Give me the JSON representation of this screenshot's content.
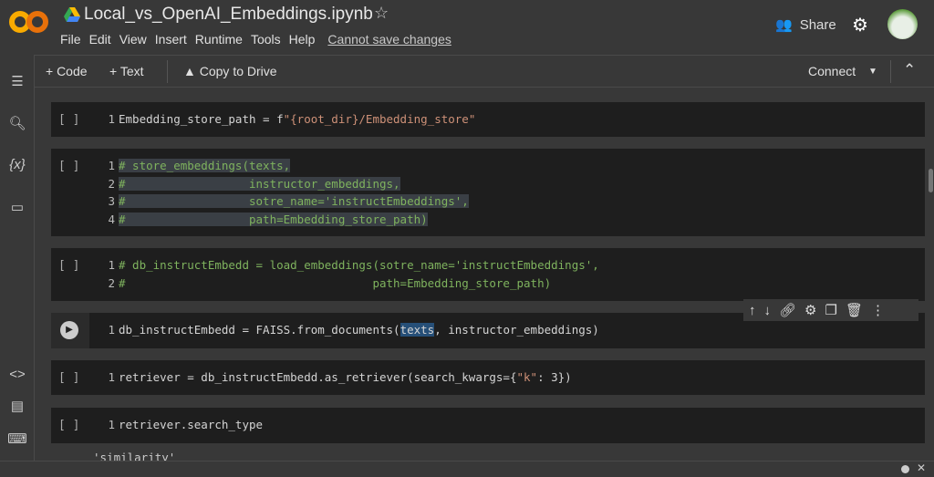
{
  "header": {
    "title": "Local_vs_OpenAI_Embeddings.ipynb",
    "menu": [
      "File",
      "Edit",
      "View",
      "Insert",
      "Runtime",
      "Tools",
      "Help"
    ],
    "warning": "Cannot save changes",
    "share": "Share",
    "logo": "CO"
  },
  "toolbar": {
    "code": "+ Code",
    "text": "+ Text",
    "copy": "Copy to Drive",
    "connect": "Connect"
  },
  "cells": [
    {
      "bracket": "[ ]",
      "lines": [
        {
          "n": "1",
          "tokens": [
            {
              "t": "Embedding_store_path = f",
              "c": "d"
            },
            {
              "t": "\"{root_dir}/Embedding_store\"",
              "c": "s"
            }
          ]
        }
      ]
    },
    {
      "bracket": "[ ]",
      "lines": [
        {
          "n": "1",
          "tokens": [
            {
              "t": "# store_embeddings(texts,",
              "c": "c",
              "sel": true
            }
          ]
        },
        {
          "n": "2",
          "tokens": [
            {
              "t": "#                  instructor_embeddings,",
              "c": "c",
              "sel": true
            }
          ]
        },
        {
          "n": "3",
          "tokens": [
            {
              "t": "#                  sotre_name='instructEmbeddings',",
              "c": "c",
              "sel": true
            }
          ]
        },
        {
          "n": "4",
          "tokens": [
            {
              "t": "#                  path=Embedding_store_path)",
              "c": "c",
              "sel": true
            }
          ]
        }
      ]
    },
    {
      "bracket": "[ ]",
      "lines": [
        {
          "n": "1",
          "tokens": [
            {
              "t": "# db_instructEmbedd = load_embeddings(sotre_name='instructEmbeddings',",
              "c": "c"
            }
          ]
        },
        {
          "n": "2",
          "tokens": [
            {
              "t": "#                                    path=Embedding_store_path)",
              "c": "c"
            }
          ]
        }
      ]
    },
    {
      "bracket": "",
      "lines": [
        {
          "n": "1",
          "tokens": [
            {
              "t": "db_instructEmbedd = FAISS.from_documents(",
              "c": "d"
            },
            {
              "t": "texts",
              "c": "d",
              "hl": true
            },
            {
              "t": ", instructor_embeddings)",
              "c": "d"
            }
          ]
        }
      ]
    },
    {
      "bracket": "[ ]",
      "lines": [
        {
          "n": "1",
          "tokens": [
            {
              "t": "retriever = db_instructEmbedd.as_retriever(search_kwargs={",
              "c": "d"
            },
            {
              "t": "\"k\"",
              "c": "s"
            },
            {
              "t": ": 3})",
              "c": "d"
            }
          ]
        }
      ]
    },
    {
      "bracket": "[ ]",
      "lines": [
        {
          "n": "1",
          "tokens": [
            {
              "t": "retriever.search_type",
              "c": "d"
            }
          ]
        }
      ]
    }
  ],
  "output": "'similarity'",
  "icons": {
    "cell_toolbar": [
      "arrow-up",
      "arrow-down",
      "link",
      "gear",
      "mirror",
      "trash",
      "more"
    ]
  }
}
